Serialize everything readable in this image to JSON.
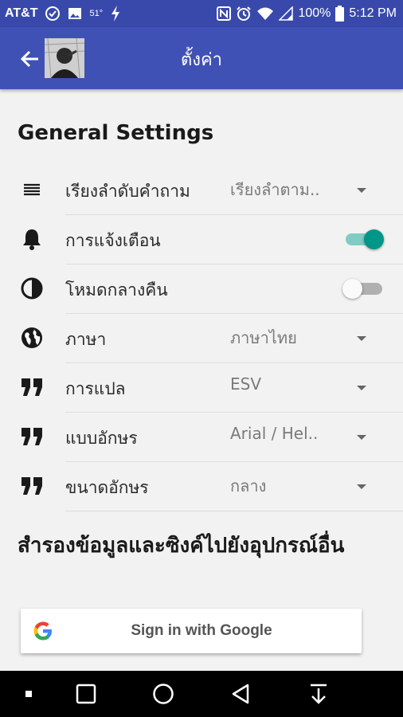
{
  "status_bar": {
    "carrier": "AT&T",
    "temperature": "51°",
    "battery": "100%",
    "time": "5:12 PM"
  },
  "app_bar": {
    "title": "ตั้งค่า"
  },
  "general": {
    "title": "General Settings",
    "rows": [
      {
        "label": "เรียงลำดับคำถาม",
        "value": "เรียงลำตาม..",
        "icon": "sort-lines-icon",
        "control": "dropdown"
      },
      {
        "label": "การแจ้งเตือน",
        "icon": "bell-icon",
        "control": "toggle",
        "on": true
      },
      {
        "label": "โหมดกลางคืน",
        "icon": "half-circle-icon",
        "control": "toggle",
        "on": false
      },
      {
        "label": "ภาษา",
        "value": "ภาษาไทย",
        "icon": "globe-icon",
        "control": "dropdown"
      },
      {
        "label": "การแปล",
        "value": "ESV",
        "icon": "quote-icon",
        "control": "dropdown"
      },
      {
        "label": "แบบอักษร",
        "value": "Arial / Hel..",
        "icon": "quote-icon",
        "control": "dropdown"
      },
      {
        "label": "ขนาดอักษร",
        "value": "กลาง",
        "icon": "quote-icon",
        "control": "dropdown"
      }
    ]
  },
  "sync": {
    "title": "สำรองข้อมูลและซิงค์ไปยังอุปกรณ์อื่น",
    "google_button": "Sign in with Google"
  },
  "colors": {
    "status_bar": "#3949ab",
    "app_bar": "#3f51b5",
    "toggle_on": "#009688"
  }
}
